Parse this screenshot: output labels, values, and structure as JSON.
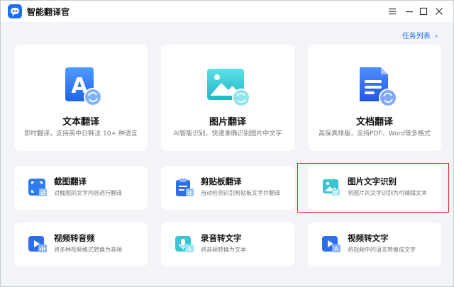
{
  "window": {
    "title": "智能翻译官",
    "controls": [
      "menu",
      "minimize",
      "maximize",
      "close"
    ]
  },
  "header": {
    "task_list_label": "任务列表",
    "task_list_chevron": "›"
  },
  "big_cards": [
    {
      "title": "文本翻译",
      "desc": "即时翻译，支持英中日韩法 10+ 种语言",
      "letter": "A"
    },
    {
      "title": "图片翻译",
      "desc": "AI智能识别，快速准确识别图片中文字"
    },
    {
      "title": "文档翻译",
      "desc": "高保真排版，支持PDF、Word等多格式"
    }
  ],
  "small_cards": [
    {
      "title": "截图翻译",
      "desc": "对截图的文字内容进行翻译",
      "badge": "译"
    },
    {
      "title": "剪贴板翻译",
      "desc": "自动检测识别剪贴板文字并翻译",
      "badge": "译"
    },
    {
      "title": "图片文字识别",
      "desc": "将图片的文字识别为可编辑文本"
    },
    {
      "title": "视频转音频",
      "desc": "将多种视频格式转换为音频"
    },
    {
      "title": "录音转文字",
      "desc": "将音频转换为文本",
      "badge": "A"
    },
    {
      "title": "视频转文字",
      "desc": "将视频中的语言转换成文字",
      "badge": "A"
    }
  ],
  "colors": {
    "accent": "#1f6fe5",
    "highlight_border": "#e02020",
    "teal": "#2fc0d0"
  }
}
